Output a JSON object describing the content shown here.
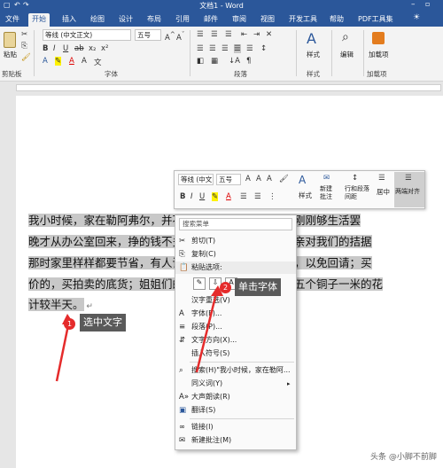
{
  "window": {
    "title": "文档1 - Word"
  },
  "tabs": [
    "文件",
    "开始",
    "插入",
    "绘图",
    "设计",
    "布局",
    "引用",
    "邮件",
    "审阅",
    "视图",
    "开发工具",
    "帮助",
    "PDF工具集"
  ],
  "ribbon": {
    "clipboard": {
      "paste": "粘贴",
      "label": "剪贴板"
    },
    "font": {
      "name": "等线 (中文正文)",
      "size": "五号",
      "label": "字体"
    },
    "paragraph": {
      "label": "段落"
    },
    "styles": {
      "btn": "样式",
      "label": "样式"
    },
    "editing": {
      "btn": "编辑"
    },
    "load": {
      "btn": "加载项",
      "label": "加载项"
    }
  },
  "document": {
    "lines": [
      "我小时候，家在勒阿弗尔，并不是有钱的人家，也就是刚刚够生活罢",
      "晚才从办公室回来，挣的钱不多。我有两个姐姐。我母亲对我们的拮据",
      "那时家里样样都要节省，有人请吃饭是从来不敢答应的，以免回请；买",
      "价的，买拍卖的底货；姐姐们的长袍是自己做的，买十五个铜子一米的花",
      "计较半天。"
    ]
  },
  "mini_toolbar": {
    "font_name": "等线 (中文",
    "font_size": "五号",
    "styles": "样式",
    "new_comment": "新建批注",
    "line_spacing": "行和段落间距",
    "center": "居中",
    "justify": "两端对齐"
  },
  "context_menu": {
    "search_placeholder": "搜索菜单",
    "cut": "剪切(T)",
    "copy": "复制(C)",
    "paste_options": "粘贴选项:",
    "hanzi_reselect": "汉字重选(V)",
    "font": "字体(F)...",
    "paragraph": "段落(P)...",
    "text_direction": "文字方向(X)...",
    "insert_symbol": "插入符号(S)",
    "search": "搜索(H)\"我小时候，家在勒阿...",
    "synonyms": "同义词(Y)",
    "read_aloud": "大声朗读(R)",
    "translate": "翻译(S)",
    "link": "链接(I)",
    "new_comment": "新建批注(M)"
  },
  "annotations": {
    "step1_num": "1",
    "step1_text": "选中文字",
    "step2_num": "2",
    "step2_text": "单击字体"
  },
  "watermark": "头条 @小脚不前脚",
  "colors": {
    "word_blue": "#2b579a",
    "annotation_red": "#e52b2b",
    "callout_gray": "#5a5a5a"
  }
}
